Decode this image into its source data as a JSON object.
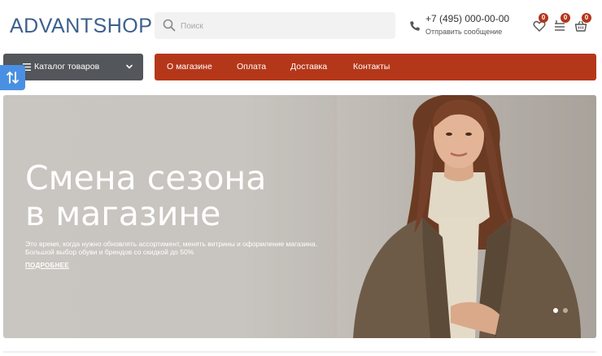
{
  "header": {
    "logo": "ADVANTSHOP",
    "search_placeholder": "Поиск",
    "phone": "+7 (495) 000-00-00",
    "message_link": "Отправить сообщение",
    "wishlist_count": "0",
    "compare_count": "0",
    "cart_count": "0"
  },
  "catalog": {
    "label": "Каталог товаров"
  },
  "nav": {
    "items": [
      "О магазине",
      "Оплата",
      "Доставка",
      "Контакты"
    ]
  },
  "banner": {
    "title_line1": "Смена сезона",
    "title_line2": "в магазине",
    "description": "Это время, когда нужно обновлять ассортимент, менять витрины и оформление магазина. Большой выбор обуви и брендов со скидкой до 50%",
    "more_link": "ПОДРОБНЕЕ",
    "slides_total": 2,
    "active_slide": 1
  },
  "colors": {
    "brand_blue": "#3b5f8c",
    "nav_red": "#b5371a",
    "catalog_gray": "#53565a",
    "filter_blue": "#4a90e2"
  },
  "icons": [
    "search-icon",
    "phone-icon",
    "heart-icon",
    "compare-icon",
    "cart-icon",
    "menu-icon",
    "chevron-down-icon",
    "filter-icon"
  ]
}
